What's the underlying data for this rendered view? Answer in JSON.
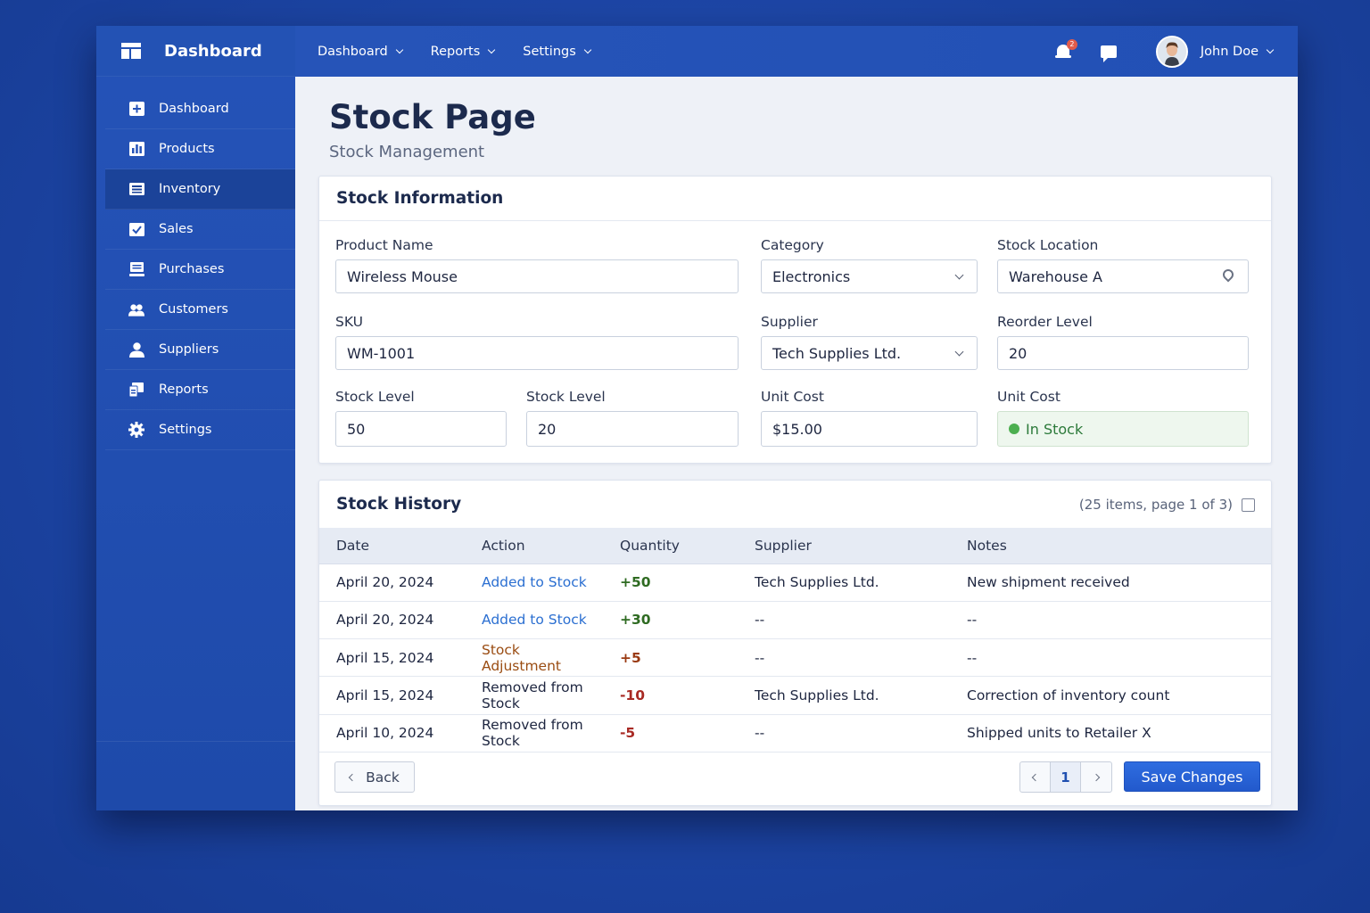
{
  "sidebar": {
    "brand": "Dashboard",
    "items": [
      {
        "label": "Dashboard",
        "icon": "plus-square-icon"
      },
      {
        "label": "Products",
        "icon": "bar-chart-icon"
      },
      {
        "label": "Inventory",
        "icon": "list-icon",
        "active": true
      },
      {
        "label": "Sales",
        "icon": "check-square-icon"
      },
      {
        "label": "Purchases",
        "icon": "monitor-icon"
      },
      {
        "label": "Customers",
        "icon": "users-icon"
      },
      {
        "label": "Suppliers",
        "icon": "user-icon"
      },
      {
        "label": "Reports",
        "icon": "report-icon"
      },
      {
        "label": "Settings",
        "icon": "gear-icon"
      }
    ]
  },
  "topbar": {
    "menu": [
      "Dashboard",
      "Reports",
      "Settings"
    ],
    "notification_badge": "2",
    "user_name": "John Doe"
  },
  "page": {
    "title": "Stock Page",
    "subtitle": "Stock Management"
  },
  "stock_info": {
    "heading": "Stock Information",
    "product_name": {
      "label": "Product Name",
      "value": "Wireless Mouse"
    },
    "category": {
      "label": "Category",
      "value": "Electronics"
    },
    "stock_location": {
      "label": "Stock Location",
      "value": "Warehouse A"
    },
    "sku": {
      "label": "SKU",
      "value": "WM-1001"
    },
    "supplier": {
      "label": "Supplier",
      "value": "Tech Supplies Ltd."
    },
    "reorder_level": {
      "label": "Reorder Level",
      "value": "20"
    },
    "stock_level_1": {
      "label": "Stock Level",
      "value": "50"
    },
    "stock_level_2": {
      "label": "Stock Level",
      "value": "20"
    },
    "unit_cost": {
      "label": "Unit Cost",
      "value": "$15.00"
    },
    "unit_cost_status": {
      "label": "Unit Cost",
      "value": "In Stock"
    }
  },
  "history": {
    "heading": "Stock History",
    "meta": "(25 items, page 1 of 3)",
    "columns": [
      "Date",
      "Action",
      "Quantity",
      "Supplier",
      "Notes"
    ],
    "rows": [
      {
        "date": "April 20, 2024",
        "action": "Added to Stock",
        "qty": "+50",
        "supplier": "Tech Supplies Ltd.",
        "notes": "New shipment received"
      },
      {
        "date": "April 20, 2024",
        "action": "Added to Stock",
        "qty": "+30",
        "supplier": "--",
        "notes": "--"
      },
      {
        "date": "April 15, 2024",
        "action": "Stock Adjustment",
        "qty": "+5",
        "supplier": "--",
        "notes": "--"
      },
      {
        "date": "April 15, 2024",
        "action": "Removed from Stock",
        "qty": "-10",
        "supplier": "Tech Supplies Ltd.",
        "notes": "Correction of inventory count"
      },
      {
        "date": "April 10, 2024",
        "action": "Removed from Stock",
        "qty": "-5",
        "supplier": "--",
        "notes": "Shipped units to Retailer X"
      }
    ],
    "back_label": "Back",
    "current_page": "1",
    "save_label": "Save Changes"
  },
  "colors": {
    "accent": "#2259cc",
    "sidebar": "#1e4aaa",
    "positive": "#2f6b22",
    "negative": "#a82a24",
    "in_stock": "#4caf50"
  }
}
